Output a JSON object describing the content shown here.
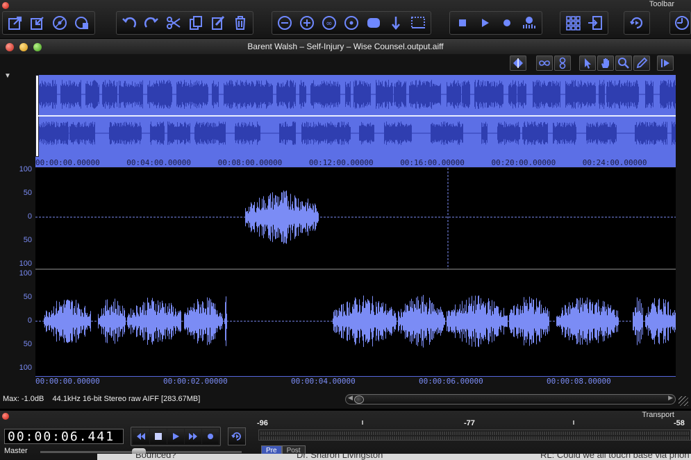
{
  "toolbar": {
    "title": "Toolbar",
    "groups": [
      {
        "name": "file",
        "buttons": [
          "export-icon",
          "import-icon",
          "burn-cd-icon",
          "cd-settings-icon"
        ]
      },
      {
        "name": "edit",
        "buttons": [
          "undo-icon",
          "redo-icon",
          "cut-icon",
          "copy-icon",
          "paste-icon",
          "delete-icon"
        ]
      },
      {
        "name": "zoom",
        "buttons": [
          "zoom-out-icon",
          "zoom-in-icon",
          "zoom-all-icon",
          "zoom-selection-icon",
          "fit-icon",
          "insertion-point-icon",
          "marker-icon"
        ]
      },
      {
        "name": "transport",
        "buttons": [
          "stop-icon",
          "play-icon",
          "record-icon",
          "meter-icon"
        ]
      },
      {
        "name": "view",
        "buttons": [
          "grid-icon",
          "import-file-icon"
        ]
      },
      {
        "name": "loop",
        "buttons": [
          "loop-icon"
        ]
      },
      {
        "name": "time",
        "buttons": [
          "clock-icon"
        ]
      }
    ]
  },
  "editor": {
    "title": "Barent Walsh – Self-Injury – Wise Counsel.output.aiff",
    "tools": [
      "marker-diamond-icon",
      "loop-icon",
      "infinite-icon",
      "pointer-icon",
      "hand-icon",
      "magnify-icon",
      "pencil-icon",
      "play-selection-icon"
    ],
    "overview_ticks": [
      "00:00:00.00000",
      "00:04:00.00000",
      "00:08:00.00000",
      "00:12:00.00000",
      "00:16:00.00000",
      "00:20:00.00000",
      "00:24:00.00000"
    ],
    "scale_top": [
      "100",
      "50",
      "0",
      "50",
      "100"
    ],
    "scale_bottom": [
      "100",
      "50",
      "0",
      "50",
      "100"
    ],
    "main_ticks": [
      "00:00:00.00000",
      "00:00:02.00000",
      "00:00:04.00000",
      "00:00:06.00000",
      "00:00:08.00000"
    ],
    "status_max": "Max: -1.0dB",
    "status_format": "44.1kHz 16-bit Stereo raw  AIFF [283.67MB]"
  },
  "transport": {
    "title": "Transport",
    "time": "00:00:06.441",
    "master_label": "Master",
    "meter_labels": [
      "-96",
      "-77",
      "-58"
    ],
    "tab_pre": "Pre",
    "tab_post": "Post"
  },
  "background_text": {
    "a": "Bounced?",
    "b": "Dr. Sharon Livingston",
    "c": "RL: Could we all touch base via phon"
  },
  "colors": {
    "waveform": "#7b8cf5",
    "overview_bg": "#5c6fe6",
    "overview_wave": "#2f3eb0"
  }
}
